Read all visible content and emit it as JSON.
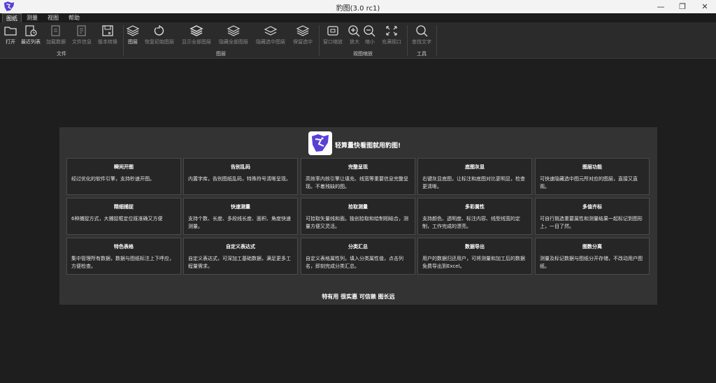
{
  "window": {
    "title": "豹图(3.0 rc1)",
    "minimize": "—",
    "maximize": "❐",
    "close": "✕"
  },
  "menu": [
    {
      "label": "图纸",
      "active": true
    },
    {
      "label": "测量"
    },
    {
      "label": "视图"
    },
    {
      "label": "帮助"
    }
  ],
  "ribbon": {
    "buttons": [
      {
        "label": "打开",
        "icon": "folder-icon",
        "enabled": true
      },
      {
        "label": "最近列表",
        "icon": "recent-list-icon",
        "enabled": true
      },
      {
        "label": "加载数据",
        "icon": "load-data-icon",
        "enabled": false
      },
      {
        "label": "文件信息",
        "icon": "file-info-icon",
        "enabled": false
      },
      {
        "label": "版本转换",
        "icon": "save-convert-icon",
        "enabled": false
      },
      {
        "label": "图层",
        "icon": "layers-icon",
        "enabled": true
      },
      {
        "label": "恢复初始图层",
        "icon": "restore-icon",
        "enabled": false
      },
      {
        "label": "显示全部图层",
        "icon": "show-layers-icon",
        "enabled": false
      },
      {
        "label": "隐藏全部图层",
        "icon": "hide-layers-icon",
        "enabled": false
      },
      {
        "label": "隐藏选中图层",
        "icon": "hide-selected-layer-icon",
        "enabled": false
      },
      {
        "label": "保留选中",
        "icon": "keep-selected-icon",
        "enabled": false
      },
      {
        "label": "窗口缩放",
        "icon": "window-zoom-icon",
        "enabled": false
      },
      {
        "label": "放大",
        "icon": "zoom-in-icon",
        "enabled": false
      },
      {
        "label": "缩小",
        "icon": "zoom-out-icon",
        "enabled": false
      },
      {
        "label": "充满视口",
        "icon": "fit-view-icon",
        "enabled": false
      },
      {
        "label": "查找文字",
        "icon": "search-icon",
        "enabled": false
      }
    ],
    "groups": [
      "文件",
      "图层",
      "视图缩放",
      "工具"
    ]
  },
  "panel": {
    "title": "轻算量快看图就用豹图!",
    "features": [
      {
        "title": "瞬间开图",
        "desc": "经过优化的软件引擎，支持秒速开图。"
      },
      {
        "title": "告别乱码",
        "desc": "内置字库，告别图纸乱码，特殊符号清晰呈现。"
      },
      {
        "title": "完整呈现",
        "desc": "高效率内核引擎让填充、线宽等重要信息完整呈现。不着残缺的图。"
      },
      {
        "title": "底图灰显",
        "desc": "右键灰显底图，让标注和底图对比更明显，检查更清晰。"
      },
      {
        "title": "图层功能",
        "desc": "可快速隐藏选中图元所对应的图层，直接又直观。"
      },
      {
        "title": "精细捕捉",
        "desc": "6种捕捉方式，大捕捉框定位既准确又方便"
      },
      {
        "title": "快速测量",
        "desc": "支持个数、长度、多段线长度、面积、角度快速测量。"
      },
      {
        "title": "拾取测量",
        "desc": "可拾取矢量线和面。独创拾取和绘制相结合，测量方便又灵活。"
      },
      {
        "title": "多彩属性",
        "desc": "支持颜色、透明度、标注内容、线型线宽的定制，工作完成的漂亮。"
      },
      {
        "title": "多值齐标",
        "desc": "可自行挑选重要属性和测量结果一起标记到图形上，一目了然。"
      },
      {
        "title": "特色表格",
        "desc": "集中管理所有数据，数据与图纸标注上下呼应，方便检查。"
      },
      {
        "title": "自定义表达式",
        "desc": "自定义表达式，可深加工基础数据，满足更多工程量需求。"
      },
      {
        "title": "分类汇总",
        "desc": "自定义表格属性列，填入分类属性值，点击列名，即刻完成分类汇总。"
      },
      {
        "title": "数据导出",
        "desc": "用户的数据归还用户，可将测量和加工后的数据免费导出到Excel。"
      },
      {
        "title": "图数分离",
        "desc": "测量及标记数据与图纸分开存储，不改动用户图纸。"
      }
    ],
    "slogan": "特有用 很实惠 可信赖 图长远"
  },
  "colors": {
    "background": "#1e1e1e",
    "panel": "#333333",
    "card": "#262626",
    "ribbon": "#2b2b2b",
    "logo_purple": "#5a3fd6"
  }
}
